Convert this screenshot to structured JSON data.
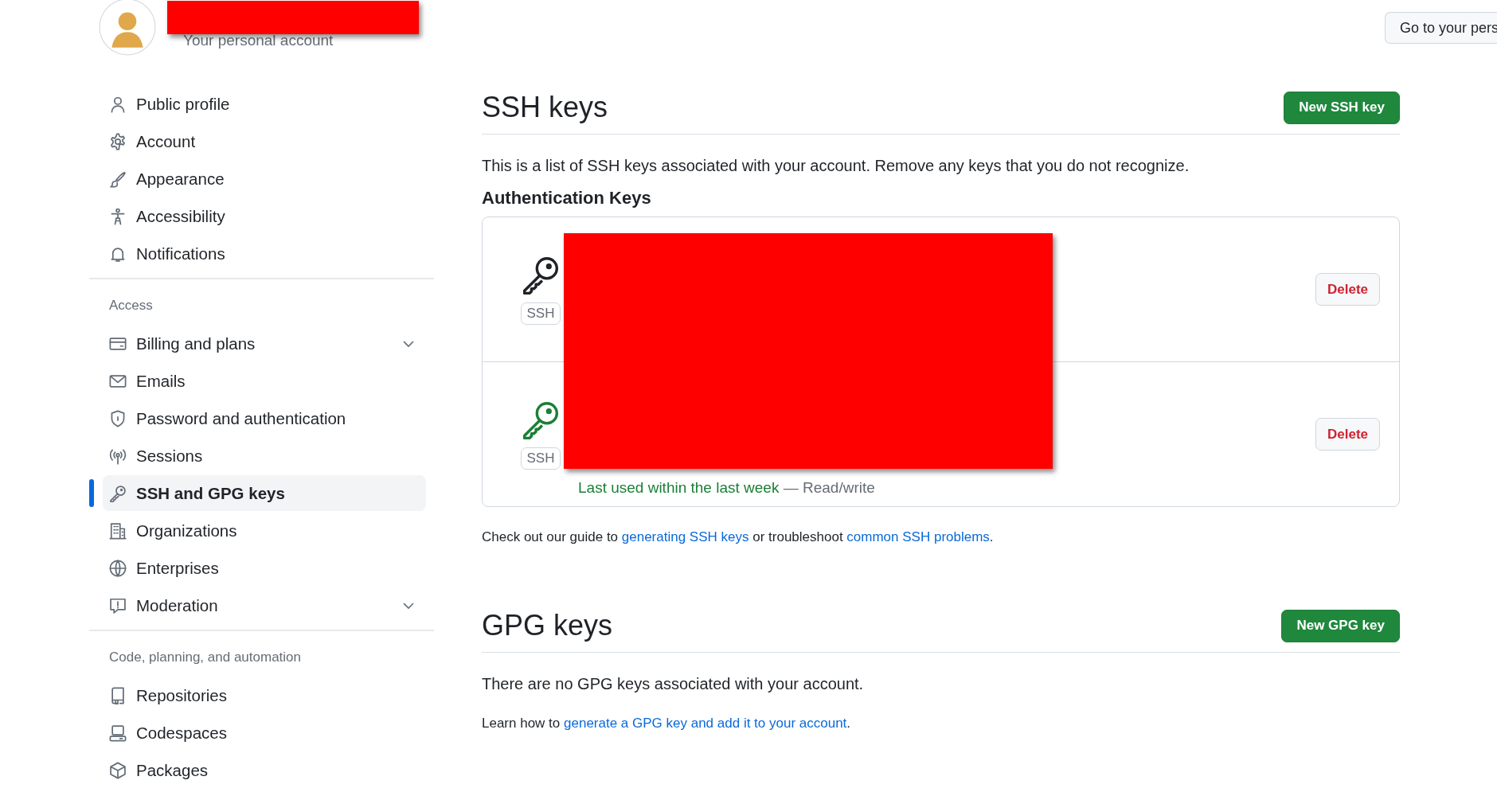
{
  "header": {
    "subtitle": "Your personal account",
    "redacted": true,
    "button": "Go to your pers"
  },
  "sidebar": {
    "sections": [
      {
        "items": [
          {
            "label": "Public profile",
            "selected": false
          },
          {
            "label": "Account",
            "selected": false
          },
          {
            "label": "Appearance",
            "selected": false
          },
          {
            "label": "Accessibility",
            "selected": false
          },
          {
            "label": "Notifications",
            "selected": false
          }
        ]
      },
      {
        "heading": "Access",
        "items": [
          {
            "label": "Billing and plans",
            "selected": false,
            "expandable": true
          },
          {
            "label": "Emails",
            "selected": false
          },
          {
            "label": "Password and authentication",
            "selected": false
          },
          {
            "label": "Sessions",
            "selected": false
          },
          {
            "label": "SSH and GPG keys",
            "selected": true
          },
          {
            "label": "Organizations",
            "selected": false
          },
          {
            "label": "Enterprises",
            "selected": false
          },
          {
            "label": "Moderation",
            "selected": false,
            "expandable": true
          }
        ]
      },
      {
        "heading": "Code, planning, and automation",
        "items": [
          {
            "label": "Repositories",
            "selected": false
          },
          {
            "label": "Codespaces",
            "selected": false
          },
          {
            "label": "Packages",
            "selected": false
          }
        ]
      }
    ]
  },
  "ssh": {
    "title": "SSH keys",
    "new_button": "New SSH key",
    "description": "This is a list of SSH keys associated with your account. Remove any keys that you do not recognize.",
    "subtitle": "Authentication Keys",
    "keys": [
      {
        "badge": "SSH",
        "used": false,
        "delete": "Delete"
      },
      {
        "badge": "SSH",
        "used": true,
        "last_used": "Last used within the last week",
        "access": "— Read/write",
        "delete": "Delete"
      }
    ],
    "redacted": true,
    "guide": {
      "before": "Check out our guide to ",
      "link1": "generating SSH keys",
      "middle": " or troubleshoot ",
      "link2": "common SSH problems",
      "after": "."
    }
  },
  "gpg": {
    "title": "GPG keys",
    "new_button": "New GPG key",
    "empty": "There are no GPG keys associated with your account.",
    "learn": {
      "before": "Learn how to ",
      "link": "generate a GPG key and add it to your account",
      "after": "."
    }
  }
}
